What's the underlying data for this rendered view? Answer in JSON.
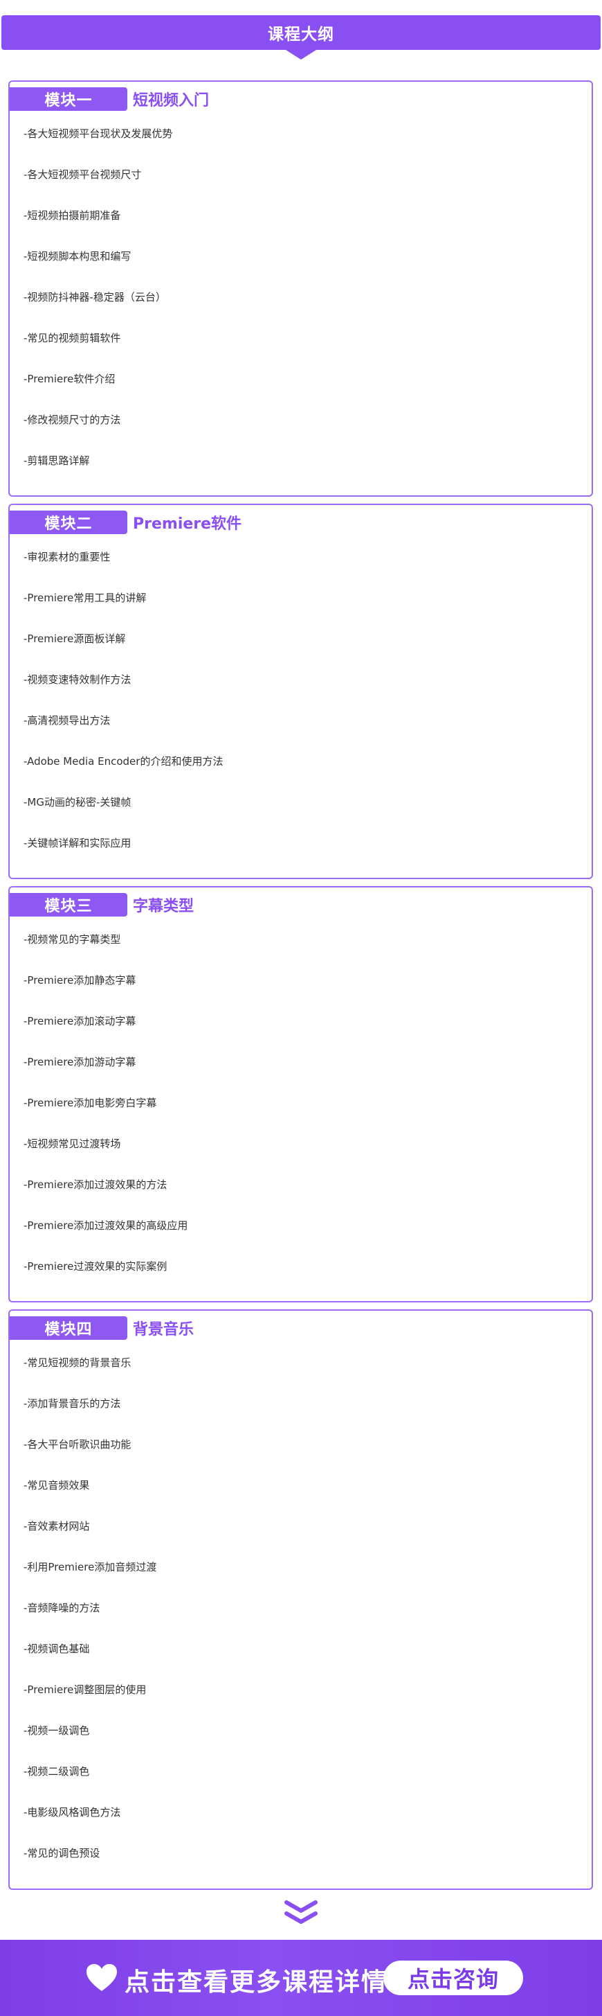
{
  "header": {
    "title": "课程大纲"
  },
  "modules": [
    {
      "tag": "模块一",
      "name": "短视频入门",
      "items": [
        "-各大短视频平台现状及发展优势",
        "-各大短视频平台视频尺寸",
        "-短视频拍摄前期准备",
        "-短视频脚本构思和编写",
        "-视频防抖神器-稳定器（云台）",
        "-常见的视频剪辑软件",
        "-Premiere软件介绍",
        "-修改视频尺寸的方法",
        "-剪辑思路详解"
      ]
    },
    {
      "tag": "模块二",
      "name": "Premiere软件",
      "items": [
        "-审视素材的重要性",
        "-Premiere常用工具的讲解",
        "-Premiere源面板详解",
        "-视频变速特效制作方法",
        "-高清视频导出方法",
        "-Adobe Media Encoder的介绍和使用方法",
        "-MG动画的秘密-关键帧",
        "-关键帧详解和实际应用"
      ]
    },
    {
      "tag": "模块三",
      "name": "字幕类型",
      "items": [
        "-视频常见的字幕类型",
        "-Premiere添加静态字幕",
        "-Premiere添加滚动字幕",
        "-Premiere添加游动字幕",
        "-Premiere添加电影旁白字幕",
        "-短视频常见过渡转场",
        "-Premiere添加过渡效果的方法",
        "-Premiere添加过渡效果的高级应用",
        "-Premiere过渡效果的实际案例"
      ]
    },
    {
      "tag": "模块四",
      "name": "背景音乐",
      "items": [
        "-常见短视频的背景音乐",
        "-添加背景音乐的方法",
        "-各大平台听歌识曲功能",
        "-常见音频效果",
        "-音效素材网站",
        "-利用Premiere添加音频过渡",
        "-音频降噪的方法",
        "-视频调色基础",
        "-Premiere调整图层的使用",
        "-视频一级调色",
        "-视频二级调色",
        "-电影级风格调色方法",
        "-常见的调色预设"
      ]
    }
  ],
  "banner": {
    "icon": "heart-icon",
    "text": "点击查看更多课程详情",
    "button_label": "点击咨询"
  },
  "colors": {
    "accent": "#8a4ff2",
    "border": "#9b6cf4"
  }
}
